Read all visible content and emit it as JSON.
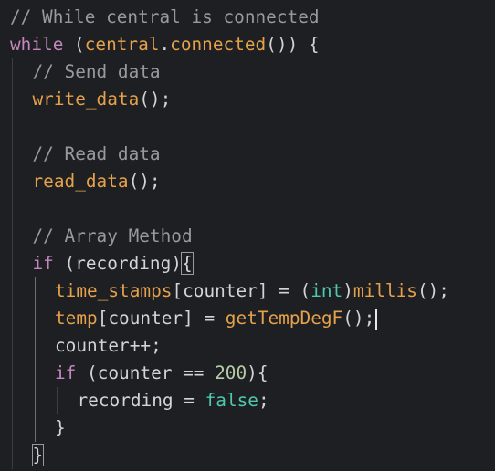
{
  "editor": {
    "lines": [
      {
        "indent": 0,
        "tokens": [
          {
            "t": "// While central is connected",
            "c": "comment"
          }
        ]
      },
      {
        "indent": 0,
        "tokens": [
          {
            "t": "while",
            "c": "kw"
          },
          {
            "t": " (",
            "c": "punc"
          },
          {
            "t": "central",
            "c": "member"
          },
          {
            "t": ".",
            "c": "punc"
          },
          {
            "t": "connected",
            "c": "fn"
          },
          {
            "t": "()) {",
            "c": "punc"
          }
        ]
      },
      {
        "indent": 1,
        "tokens": [
          {
            "t": "// Send data",
            "c": "comment"
          }
        ]
      },
      {
        "indent": 1,
        "tokens": [
          {
            "t": "write_data",
            "c": "fn"
          },
          {
            "t": "();",
            "c": "punc"
          }
        ]
      },
      {
        "indent": 1,
        "tokens": []
      },
      {
        "indent": 1,
        "tokens": [
          {
            "t": "// Read data",
            "c": "comment"
          }
        ]
      },
      {
        "indent": 1,
        "tokens": [
          {
            "t": "read_data",
            "c": "fn"
          },
          {
            "t": "();",
            "c": "punc"
          }
        ]
      },
      {
        "indent": 1,
        "tokens": []
      },
      {
        "indent": 1,
        "tokens": [
          {
            "t": "// Array Method",
            "c": "comment"
          }
        ]
      },
      {
        "indent": 1,
        "tokens": [
          {
            "t": "if",
            "c": "kw"
          },
          {
            "t": " (recording)",
            "c": "var"
          },
          {
            "t": "{",
            "c": "punc",
            "box": true
          }
        ]
      },
      {
        "indent": 2,
        "tokens": [
          {
            "t": "time_stamps",
            "c": "arr"
          },
          {
            "t": "[counter] = (",
            "c": "var"
          },
          {
            "t": "int",
            "c": "ty"
          },
          {
            "t": ")",
            "c": "punc"
          },
          {
            "t": "millis",
            "c": "fn"
          },
          {
            "t": "();",
            "c": "punc"
          }
        ]
      },
      {
        "indent": 2,
        "tokens": [
          {
            "t": "temp",
            "c": "arr"
          },
          {
            "t": "[counter] = ",
            "c": "var"
          },
          {
            "t": "getTempDegF",
            "c": "fn"
          },
          {
            "t": "();",
            "c": "punc"
          }
        ],
        "caret": true
      },
      {
        "indent": 2,
        "tokens": [
          {
            "t": "counter++;",
            "c": "var"
          }
        ]
      },
      {
        "indent": 2,
        "tokens": [
          {
            "t": "if",
            "c": "kw"
          },
          {
            "t": " (counter == ",
            "c": "var"
          },
          {
            "t": "200",
            "c": "num"
          },
          {
            "t": "){",
            "c": "punc"
          }
        ]
      },
      {
        "indent": 3,
        "tokens": [
          {
            "t": "recording = ",
            "c": "var"
          },
          {
            "t": "false",
            "c": "ty"
          },
          {
            "t": ";",
            "c": "punc"
          }
        ]
      },
      {
        "indent": 2,
        "tokens": [
          {
            "t": "}",
            "c": "punc"
          }
        ]
      },
      {
        "indent": 1,
        "tokens": [
          {
            "t": "}",
            "c": "punc",
            "box": true
          }
        ]
      }
    ]
  }
}
